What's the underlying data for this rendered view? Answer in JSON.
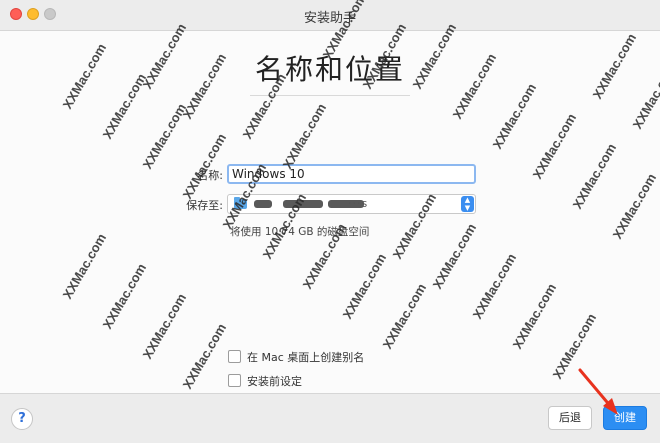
{
  "window": {
    "title": "安装助手"
  },
  "heading": "名称和位置",
  "form": {
    "name_label": "名称:",
    "name_value": "Windows 10",
    "location_label": "保存至:",
    "location_value": "···s",
    "disk_note": "将使用 10.74 GB 的磁盘空间"
  },
  "options": [
    {
      "label": "在 Mac 桌面上创建别名",
      "checked": false
    },
    {
      "label": "安装前设定",
      "checked": false
    }
  ],
  "footer": {
    "help_label": "?",
    "back_label": "后退",
    "create_label": "创建"
  },
  "watermark_text": "XXMac.com",
  "colors": {
    "accent": "#2c8ef3",
    "annotation_arrow": "#e8321e"
  }
}
